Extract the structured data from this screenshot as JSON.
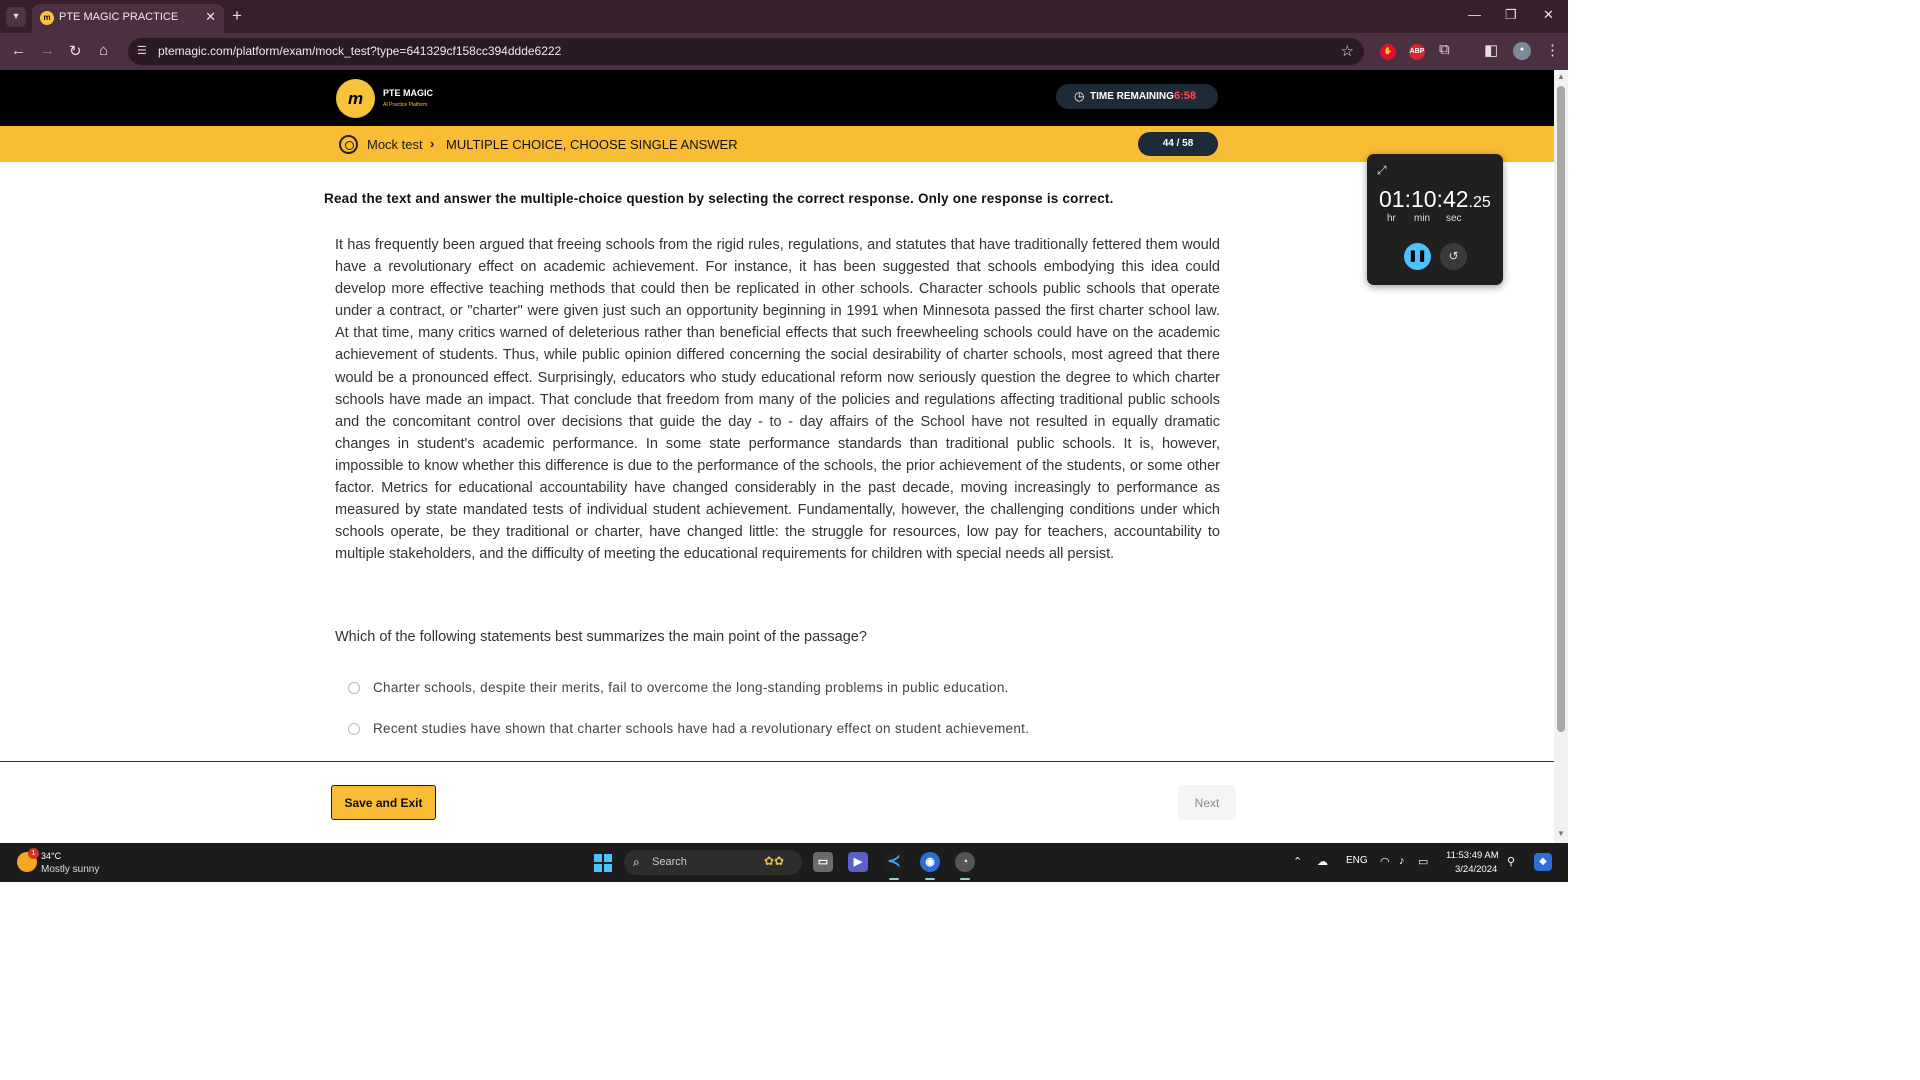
{
  "browser": {
    "tab_title": "PTE MAGIC PRACTICE",
    "tab_favicon": "pte-magic-favicon",
    "url": "ptemagic.com/platform/exam/mock_test?type=641329cf158cc394ddde6222",
    "extensions": [
      "abp-extension-icon",
      "extensions-puzzle-icon"
    ],
    "abp_label": "ABP"
  },
  "site": {
    "logo_mark": "m",
    "logo_name": "PTE MAGIC",
    "logo_tagline": "AI Practice Platform",
    "time_label": "TIME REMAINING",
    "time_value": "6:58"
  },
  "breadcrumb": {
    "root": "Mock test",
    "section": "MULTIPLE CHOICE, CHOOSE SINGLE ANSWER",
    "progress": "44 / 58"
  },
  "question": {
    "instruction": "Read the text and answer the multiple-choice question by selecting the correct response. Only one response is correct.",
    "passage": "It has frequently been argued that freeing schools from the rigid rules, regulations, and statutes that have traditionally fettered them would have a revolutionary effect on academic achievement. For instance, it has been suggested that schools embodying this idea could develop more effective teaching methods that could then be replicated in other schools. Character schools public schools that operate under a contract, or \"charter\" were given just such an opportunity beginning in 1991 when Minnesota passed the first charter school law. At that time, many critics warned of deleterious rather than beneficial effects that such freewheeling schools could have on the academic achievement of students. Thus, while public opinion differed concerning the social desirability of charter schools, most agreed that there would be a pronounced effect. Surprisingly, educators who study educational reform now seriously question the degree to which charter schools have made an impact. That conclude that freedom from many of the policies and regulations affecting traditional public schools and the concomitant control over decisions that guide the day - to - day affairs of the School have not resulted in equally dramatic changes in student's academic performance. In some state performance standards than traditional public schools. It is, however, impossible to know whether this difference is due to the performance of the schools, the prior achievement of the students, or some other factor. Metrics for educational accountability have changed considerably in the past decade, moving increasingly to performance as measured by state mandated tests of individual student achievement. Fundamentally, however, the challenging conditions under which schools operate, be they traditional or charter, have changed little: the struggle for resources, low pay for teachers, accountability to multiple stakeholders, and the difficulty of meeting the educational requirements for children with special needs all persist.",
    "prompt": "Which of the following statements best summarizes the main point of the passage?",
    "options": [
      {
        "text": "Charter schools, despite their merits, fail to overcome the long-standing problems in public education.",
        "selected": false
      },
      {
        "text": "Recent studies have shown that charter schools have had a revolutionary effect on student achievement.",
        "selected": false
      }
    ]
  },
  "footer": {
    "save_label": "Save and Exit",
    "next_label": "Next"
  },
  "stopwatch": {
    "time_main": "01:10:42",
    "time_fraction": ".25",
    "unit_hr": "hr",
    "unit_min": "min",
    "unit_sec": "sec"
  },
  "taskbar": {
    "weather_badge": "1",
    "temperature": "34°C",
    "weather": "Mostly sunny",
    "search_placeholder": "Search",
    "language": "ENG",
    "time": "11:53:49 AM",
    "date": "3/24/2024"
  },
  "colors": {
    "brand_yellow": "#f8bd35",
    "timer_red": "#ff4d4d",
    "stopwatch_accent": "#4cc2ff"
  }
}
